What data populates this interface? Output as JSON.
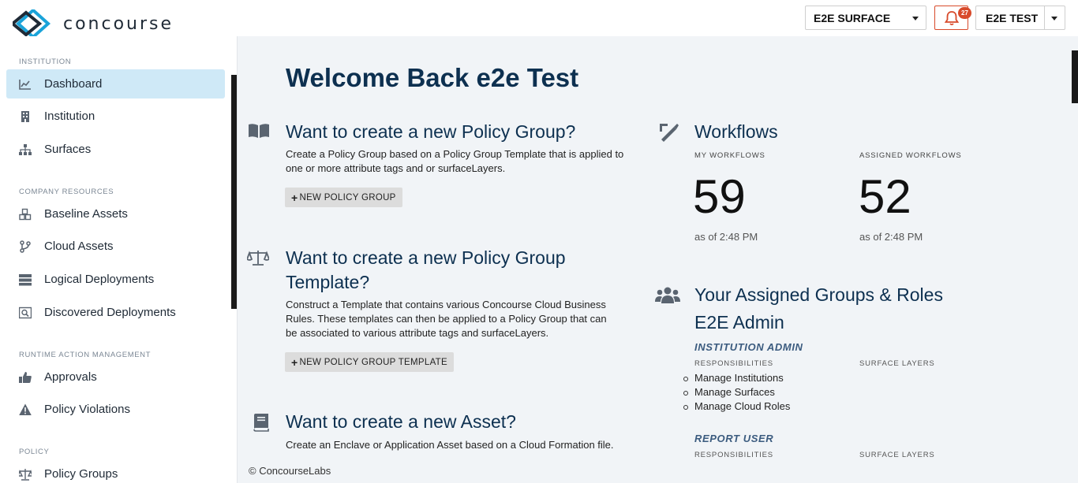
{
  "header": {
    "logo_text": "concourse",
    "surface_select": "E2E SURFACE",
    "notification_count": "27",
    "user_label": "E2E TEST"
  },
  "sidebar": {
    "sections": [
      {
        "title": "INSTITUTION"
      },
      {
        "title": "COMPANY RESOURCES"
      },
      {
        "title": "RUNTIME ACTION MANAGEMENT"
      },
      {
        "title": "POLICY"
      }
    ],
    "items": [
      {
        "label": "Dashboard",
        "icon": "chart-line-icon",
        "active": true
      },
      {
        "label": "Institution",
        "icon": "building-icon"
      },
      {
        "label": "Surfaces",
        "icon": "sitemap-icon"
      },
      {
        "label": "Baseline Assets",
        "icon": "cubes-icon"
      },
      {
        "label": "Cloud Assets",
        "icon": "code-branch-icon"
      },
      {
        "label": "Logical Deployments",
        "icon": "server-icon"
      },
      {
        "label": "Discovered Deployments",
        "icon": "search-deployment-icon"
      },
      {
        "label": "Approvals",
        "icon": "thumbs-up-icon"
      },
      {
        "label": "Policy Violations",
        "icon": "warning-icon"
      },
      {
        "label": "Policy Groups",
        "icon": "balance-scale-icon"
      }
    ]
  },
  "main": {
    "welcome": "Welcome Back e2e Test",
    "cards": [
      {
        "title": "Want to create a new Policy Group?",
        "body": "Create a Policy Group based on a Policy Group Template that is applied to one or more attribute tags and or surfaceLayers.",
        "button": "NEW POLICY GROUP",
        "icon": "book-open-icon"
      },
      {
        "title_line1": "Want to create a new Policy Group",
        "title_line2": "Template?",
        "body": "Construct a Template that contains various Concourse Cloud Business Rules. These templates can then be applied to a Policy Group that can be associated to various attribute tags and surfaceLayers.",
        "button": "NEW POLICY GROUP TEMPLATE",
        "icon": "balance-scale-icon"
      },
      {
        "title": "Want to create a new Asset?",
        "body": "Create an Enclave or Application Asset based on a Cloud Formation file.",
        "icon": "book-icon"
      }
    ],
    "workflows": {
      "title": "Workflows",
      "my_label": "MY WORKFLOWS",
      "my_count": "59",
      "my_asof": "as of 2:48 PM",
      "assigned_label": "ASSIGNED WORKFLOWS",
      "assigned_count": "52",
      "assigned_asof": "as of 2:48 PM"
    },
    "groups": {
      "title": "Your Assigned Groups & Roles",
      "group_name": "E2E Admin",
      "roles": [
        {
          "name": "INSTITUTION ADMIN",
          "responsibilities_label": "RESPONSIBILITIES",
          "surface_layers_label": "SURFACE LAYERS",
          "responsibilities": [
            "Manage Institutions",
            "Manage Surfaces",
            "Manage Cloud Roles"
          ]
        },
        {
          "name": "REPORT USER",
          "responsibilities_label": "RESPONSIBILITIES",
          "surface_layers_label": "SURFACE LAYERS"
        }
      ]
    },
    "footer": "© ConcourseLabs"
  },
  "colors": {
    "heading": "#0d3050",
    "active_nav": "#cfe9f7",
    "alert": "#d84a2b",
    "main_bg": "#f1f4f7"
  }
}
